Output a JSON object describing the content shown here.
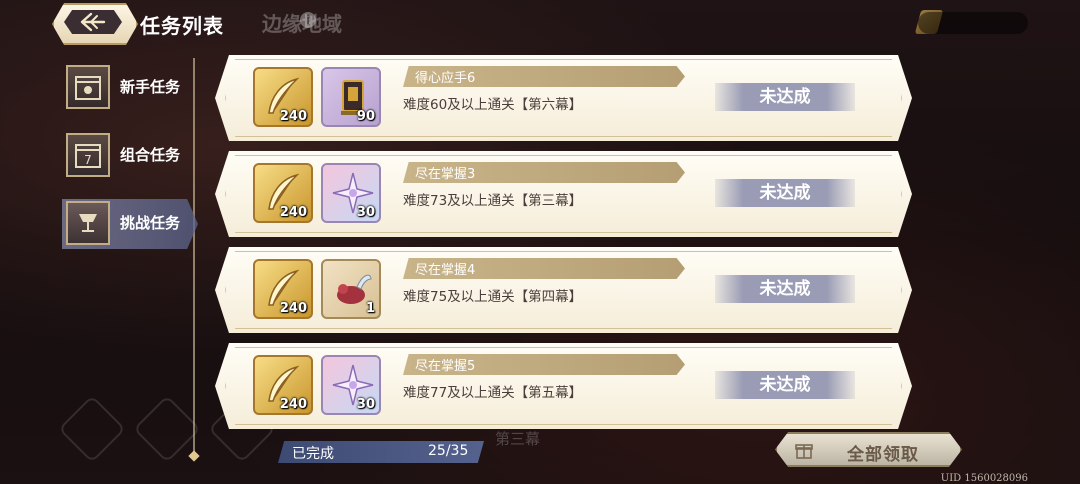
{
  "header": {
    "title": "任务列表",
    "back_icon": "back-arrow-icon"
  },
  "background": {
    "ghost_title": "边缘地域",
    "ghost_bottom": "第三幕"
  },
  "sidebar": {
    "tabs": [
      {
        "label": "新手任务",
        "icon": "calendar-sun-icon",
        "active": false
      },
      {
        "label": "组合任务",
        "icon": "calendar-7-icon",
        "icon_text": "7",
        "active": false
      },
      {
        "label": "挑战任务",
        "icon": "chalice-icon",
        "active": true
      }
    ]
  },
  "missions": [
    {
      "name": "得心应手6",
      "desc": "难度60及以上通关【第六幕】",
      "status": "未达成",
      "rewards": [
        {
          "icon": "gold-feather-icon",
          "qty": "240"
        },
        {
          "icon": "plaque-item-icon",
          "qty": "90"
        }
      ]
    },
    {
      "name": "尽在掌握3",
      "desc": "难度73及以上通关【第三幕】",
      "status": "未达成",
      "rewards": [
        {
          "icon": "gold-feather-icon",
          "qty": "240"
        },
        {
          "icon": "star-crystal-icon",
          "qty": "30"
        }
      ]
    },
    {
      "name": "尽在掌握4",
      "desc": "难度75及以上通关【第四幕】",
      "status": "未达成",
      "rewards": [
        {
          "icon": "gold-feather-icon",
          "qty": "240"
        },
        {
          "icon": "red-creature-icon",
          "qty": "1"
        }
      ]
    },
    {
      "name": "尽在掌握5",
      "desc": "难度77及以上通关【第五幕】",
      "status": "未达成",
      "rewards": [
        {
          "icon": "gold-feather-icon",
          "qty": "240"
        },
        {
          "icon": "star-crystal-icon",
          "qty": "30"
        }
      ]
    }
  ],
  "progress": {
    "label": "已完成",
    "count": "25/35"
  },
  "claim_all": {
    "label": "全部领取",
    "icon": "gift-icon"
  },
  "uid": "UID 1560028096",
  "colors": {
    "card_bg": "#fbf5e6",
    "status_bg": "#9a9cb6",
    "progress_bg": "#44507a",
    "accent_gold": "#c9962e"
  }
}
